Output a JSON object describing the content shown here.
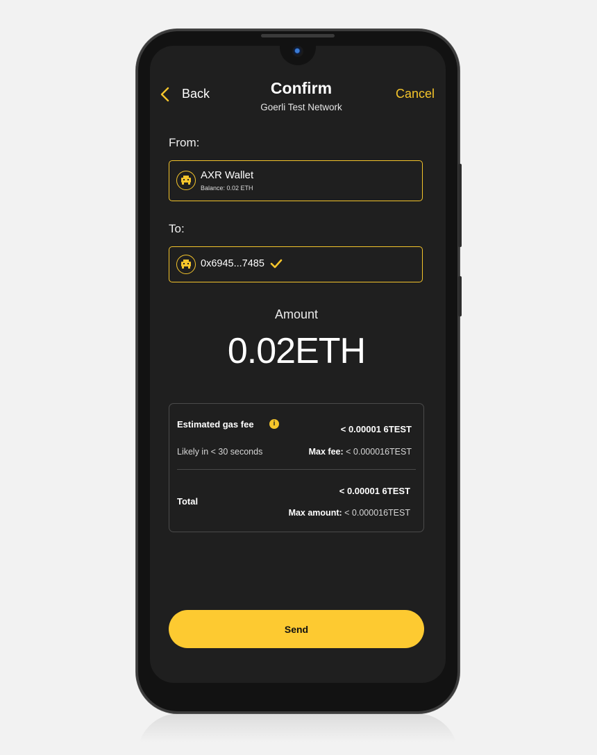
{
  "header": {
    "back_label": "Back",
    "title": "Confirm",
    "network": "Goerli Test Network",
    "cancel_label": "Cancel"
  },
  "from": {
    "label": "From:",
    "wallet_name": "AXR Wallet",
    "balance": "Balance: 0.02 ETH"
  },
  "to": {
    "label": "To:",
    "address": "0x6945...7485"
  },
  "amount": {
    "label": "Amount",
    "value": "0.02ETH"
  },
  "fees": {
    "gas_label": "Estimated gas fee",
    "gas_value": "< 0.00001 6TEST",
    "likely_text": "Likely in < 30 seconds",
    "max_fee_label": "Max fee:",
    "max_fee_value": "< 0.000016TEST",
    "total_label": "Total",
    "total_value": "< 0.00001 6TEST",
    "max_amount_label": "Max amount:",
    "max_amount_value": "< 0.000016TEST"
  },
  "actions": {
    "send_label": "Send"
  },
  "colors": {
    "accent": "#f5c52b",
    "button": "#fdca31",
    "screen_bg": "#1f1f1f"
  },
  "icons": {
    "back": "chevron-left-icon",
    "avatar": "robot-avatar-icon",
    "verified": "check-icon",
    "info": "info-icon"
  }
}
